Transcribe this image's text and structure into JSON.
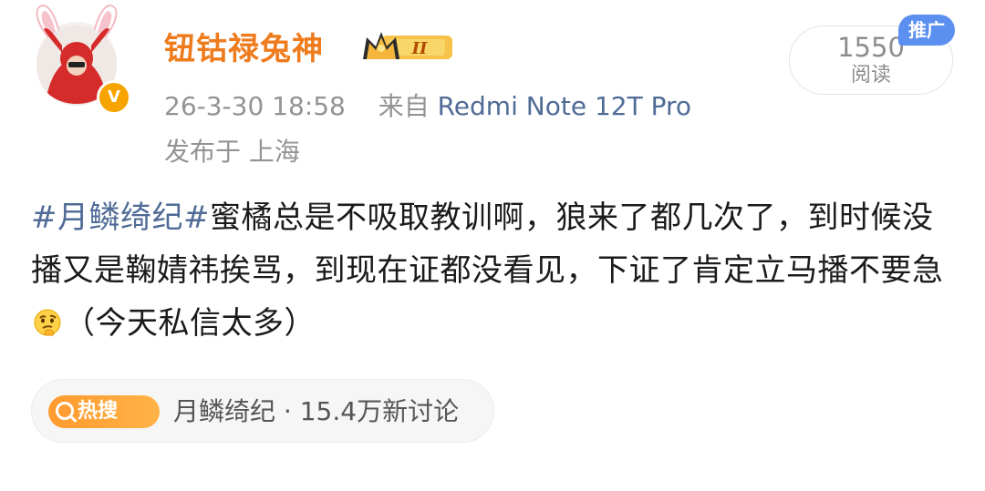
{
  "user": {
    "name": "钮钴禄兔神",
    "vip_level": "II",
    "verified_mark": "V"
  },
  "post": {
    "date": "26-3-30 18:58",
    "source_prefix": "来自",
    "source_device": "Redmi Note 12T Pro",
    "location": "发布于 上海",
    "hashtag": "#月鳞绮纪#",
    "text_before_emoji": "蜜橘总是不吸取教训啊，狼来了都几次了，到时候没播又是鞠婧祎挨骂，到现在证都没看见，下证了肯定立马播不要急",
    "text_after_emoji": "（今天私信太多）"
  },
  "stats": {
    "read_count": "1550",
    "read_label": "阅读",
    "ad_tag": "推广"
  },
  "topic": {
    "badge": "热搜",
    "name": "月鳞绮纪",
    "separator": "·",
    "discussions": "15.4万新讨论"
  },
  "icons": {
    "emoji": "thinking-face-icon",
    "crown": "crown-icon",
    "search": "search-icon"
  },
  "colors": {
    "username": "#ee7b1c",
    "link": "#4f6b96",
    "meta": "#939393",
    "ad_tag": "#5b8ff0",
    "hot_badge": "#ff9a2e"
  }
}
